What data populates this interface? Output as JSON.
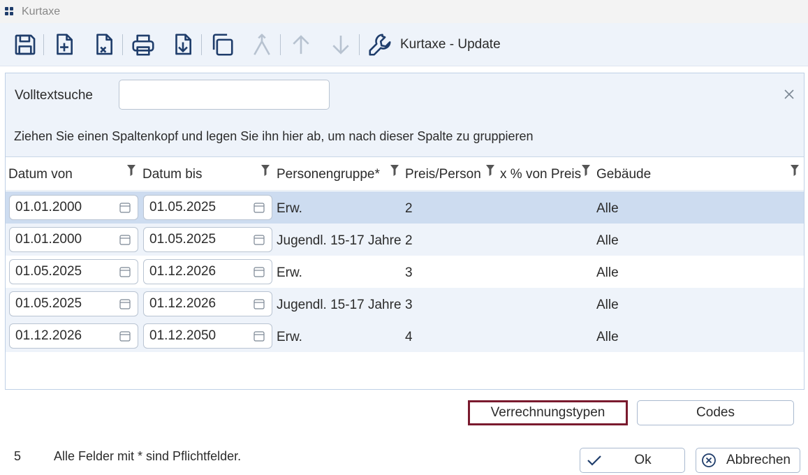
{
  "window": {
    "title": "Kurtaxe"
  },
  "toolbar": {
    "buttons": [
      "save-icon",
      "new-file-icon",
      "delete-file-icon",
      "print-icon",
      "download-icon",
      "copy-icon",
      "merge-icon",
      "arrow-up-icon",
      "arrow-down-icon",
      "wrench-icon"
    ],
    "action_label": "Kurtaxe - Update"
  },
  "search": {
    "label": "Volltextsuche",
    "value": "",
    "placeholder": ""
  },
  "group_hint": "Ziehen Sie einen Spaltenkopf und legen Sie ihn hier ab, um nach dieser Spalte zu gruppieren",
  "grid": {
    "columns": [
      "Datum von",
      "Datum bis",
      "Personengruppe*",
      "Preis/Person",
      "x % von Preis",
      "Gebäude"
    ],
    "rows": [
      {
        "von": "01.01.2000",
        "bis": "01.05.2025",
        "gruppe": "Erw.",
        "preis": "2",
        "prozent": "",
        "gebaeude": "Alle"
      },
      {
        "von": "01.01.2000",
        "bis": "01.05.2025",
        "gruppe": "Jugendl. 15-17 Jahre",
        "preis": "2",
        "prozent": "",
        "gebaeude": "Alle"
      },
      {
        "von": "01.05.2025",
        "bis": "01.12.2026",
        "gruppe": "Erw.",
        "preis": "3",
        "prozent": "",
        "gebaeude": "Alle"
      },
      {
        "von": "01.05.2025",
        "bis": "01.12.2026",
        "gruppe": "Jugendl. 15-17 Jahre",
        "preis": "3",
        "prozent": "",
        "gebaeude": "Alle"
      },
      {
        "von": "01.12.2026",
        "bis": "01.12.2050",
        "gruppe": "Erw.",
        "preis": "4",
        "prozent": "",
        "gebaeude": "Alle"
      }
    ]
  },
  "buttons": {
    "verrechnungstypen": "Verrechnungstypen",
    "codes": "Codes",
    "ok": "Ok",
    "abbrechen": "Abbrechen"
  },
  "footer": {
    "count": "5",
    "note": "Alle Felder mit * sind Pflichtfelder."
  },
  "colors": {
    "accent": "#1f3d6b",
    "selected_row": "#cddcf0",
    "alt_row": "#eef3fa",
    "focus_border": "#7a1a2e"
  }
}
